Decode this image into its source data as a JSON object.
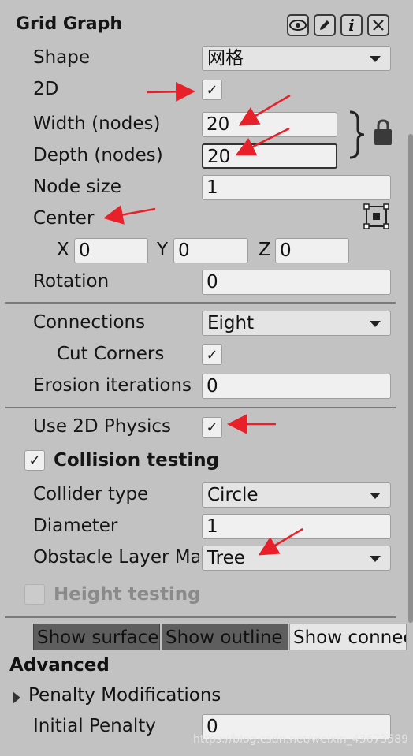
{
  "header": {
    "title": "Grid Graph",
    "icons": [
      "eye-icon",
      "pencil-icon",
      "info-icon",
      "close-icon"
    ],
    "info_glyph": "i"
  },
  "fields": {
    "shape": {
      "label": "Shape",
      "value": "网格"
    },
    "two_d": {
      "label": "2D",
      "checked": true
    },
    "width": {
      "label": "Width (nodes)",
      "value": "20"
    },
    "depth": {
      "label": "Depth (nodes)",
      "value": "20"
    },
    "node_size": {
      "label": "Node size",
      "value": "1"
    },
    "center": {
      "label": "Center",
      "x_label": "X",
      "x": "0",
      "y_label": "Y",
      "y": "0",
      "z_label": "Z",
      "z": "0"
    },
    "rotation": {
      "label": "Rotation",
      "value": "0"
    }
  },
  "connections": {
    "connections": {
      "label": "Connections",
      "value": "Eight"
    },
    "cut_corners": {
      "label": "Cut Corners",
      "checked": true
    },
    "erosion": {
      "label": "Erosion iterations",
      "value": "0"
    }
  },
  "collision": {
    "use_2d_physics": {
      "label": "Use 2D Physics",
      "checked": true
    },
    "collision_testing": {
      "label": "Collision testing",
      "checked": true
    },
    "collider_type": {
      "label": "Collider type",
      "value": "Circle"
    },
    "diameter": {
      "label": "Diameter",
      "value": "1"
    },
    "obstacle_layer": {
      "label": "Obstacle Layer Ma",
      "value": "Tree"
    },
    "height_testing": {
      "label": "Height testing",
      "checked": false
    }
  },
  "tabs": [
    "Show surface",
    "Show outline",
    "Show connec"
  ],
  "advanced": {
    "title": "Advanced",
    "penalty_mods": "Penalty Modifications",
    "initial_penalty": {
      "label": "Initial Penalty",
      "value": "0"
    }
  },
  "checkmark": "✓",
  "watermark": "https://blog.csdn.net/weixin_43673589",
  "colors": {
    "annotation_arrow": "#e8202a",
    "tab_active": "#5e5e5e",
    "panel_bg": "#c2c2c2"
  }
}
